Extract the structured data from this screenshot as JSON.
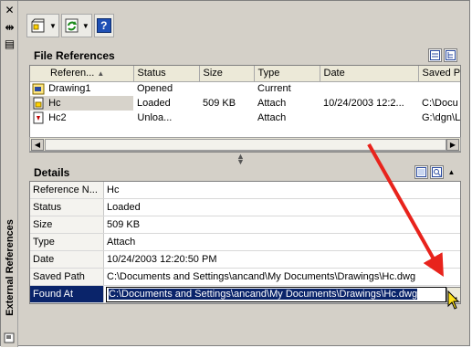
{
  "palette": {
    "title": "External References",
    "close_glyph": "✕",
    "autohide_glyph": "⇹",
    "properties_glyph": "▤"
  },
  "toolbar": {
    "attach_icon": "attach-dwg-icon",
    "refresh_icon": "refresh-icon",
    "help_icon": "help-icon",
    "help_label": "?"
  },
  "file_references": {
    "title": "File References",
    "columns": [
      "Referen...",
      "Status",
      "Size",
      "Type",
      "Date",
      "Saved Path"
    ],
    "rows": [
      {
        "name": "Drawing1",
        "status": "Opened",
        "size": "",
        "type": "Current",
        "date": "",
        "saved_path": ""
      },
      {
        "name": "Hc",
        "status": "Loaded",
        "size": "509 KB",
        "type": "Attach",
        "date": "10/24/2003 12:2...",
        "saved_path": "C:\\Docu"
      },
      {
        "name": "Hc2",
        "status": "Unloa...",
        "size": "",
        "type": "Attach",
        "date": "",
        "saved_path": "G:\\dgn\\L"
      }
    ],
    "selected_row": 1
  },
  "details": {
    "title": "Details",
    "rows": [
      {
        "label": "Reference N...",
        "value": "Hc"
      },
      {
        "label": "Status",
        "value": "Loaded"
      },
      {
        "label": "Size",
        "value": "509 KB"
      },
      {
        "label": "Type",
        "value": "Attach"
      },
      {
        "label": "Date",
        "value": "10/24/2003 12:20:50 PM"
      },
      {
        "label": "Saved Path",
        "value": "C:\\Documents and Settings\\ancand\\My Documents\\Drawings\\Hc.dwg"
      }
    ],
    "found_at": {
      "label": "Found At",
      "value": "C:\\Documents and Settings\\ancand\\My Documents\\Drawings\\Hc.dwg",
      "browse_label": "..."
    }
  },
  "colors": {
    "selection": "#0a246a",
    "annotation_arrow": "#e8231c",
    "panel_bg": "#d4d0c8"
  }
}
